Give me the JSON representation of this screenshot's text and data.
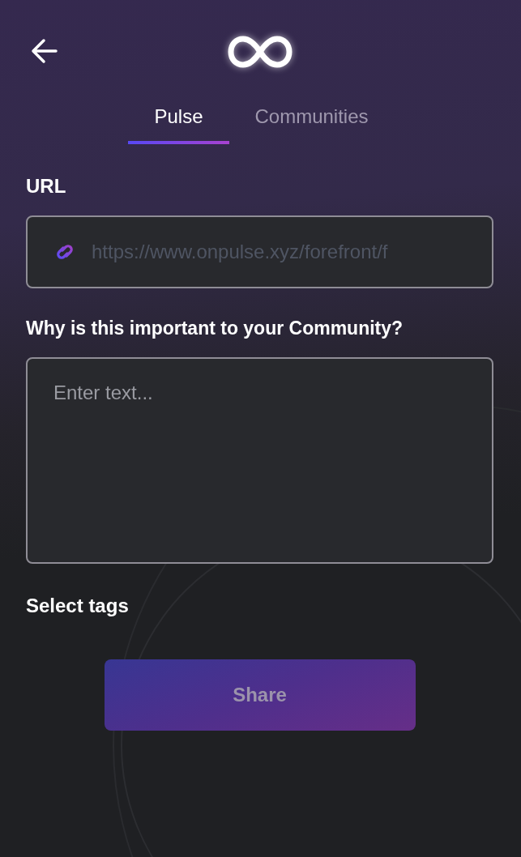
{
  "tabs": [
    {
      "label": "Pulse",
      "selected": true
    },
    {
      "label": "Communities",
      "selected": false
    }
  ],
  "url_field": {
    "label": "URL",
    "placeholder": "https://www.onpulse.xyz/forefront/f"
  },
  "reason_field": {
    "label": "Why is this important to your Community?",
    "placeholder": "Enter text..."
  },
  "tags": {
    "label": "Select tags"
  },
  "share_button": {
    "label": "Share",
    "disabled": true
  }
}
